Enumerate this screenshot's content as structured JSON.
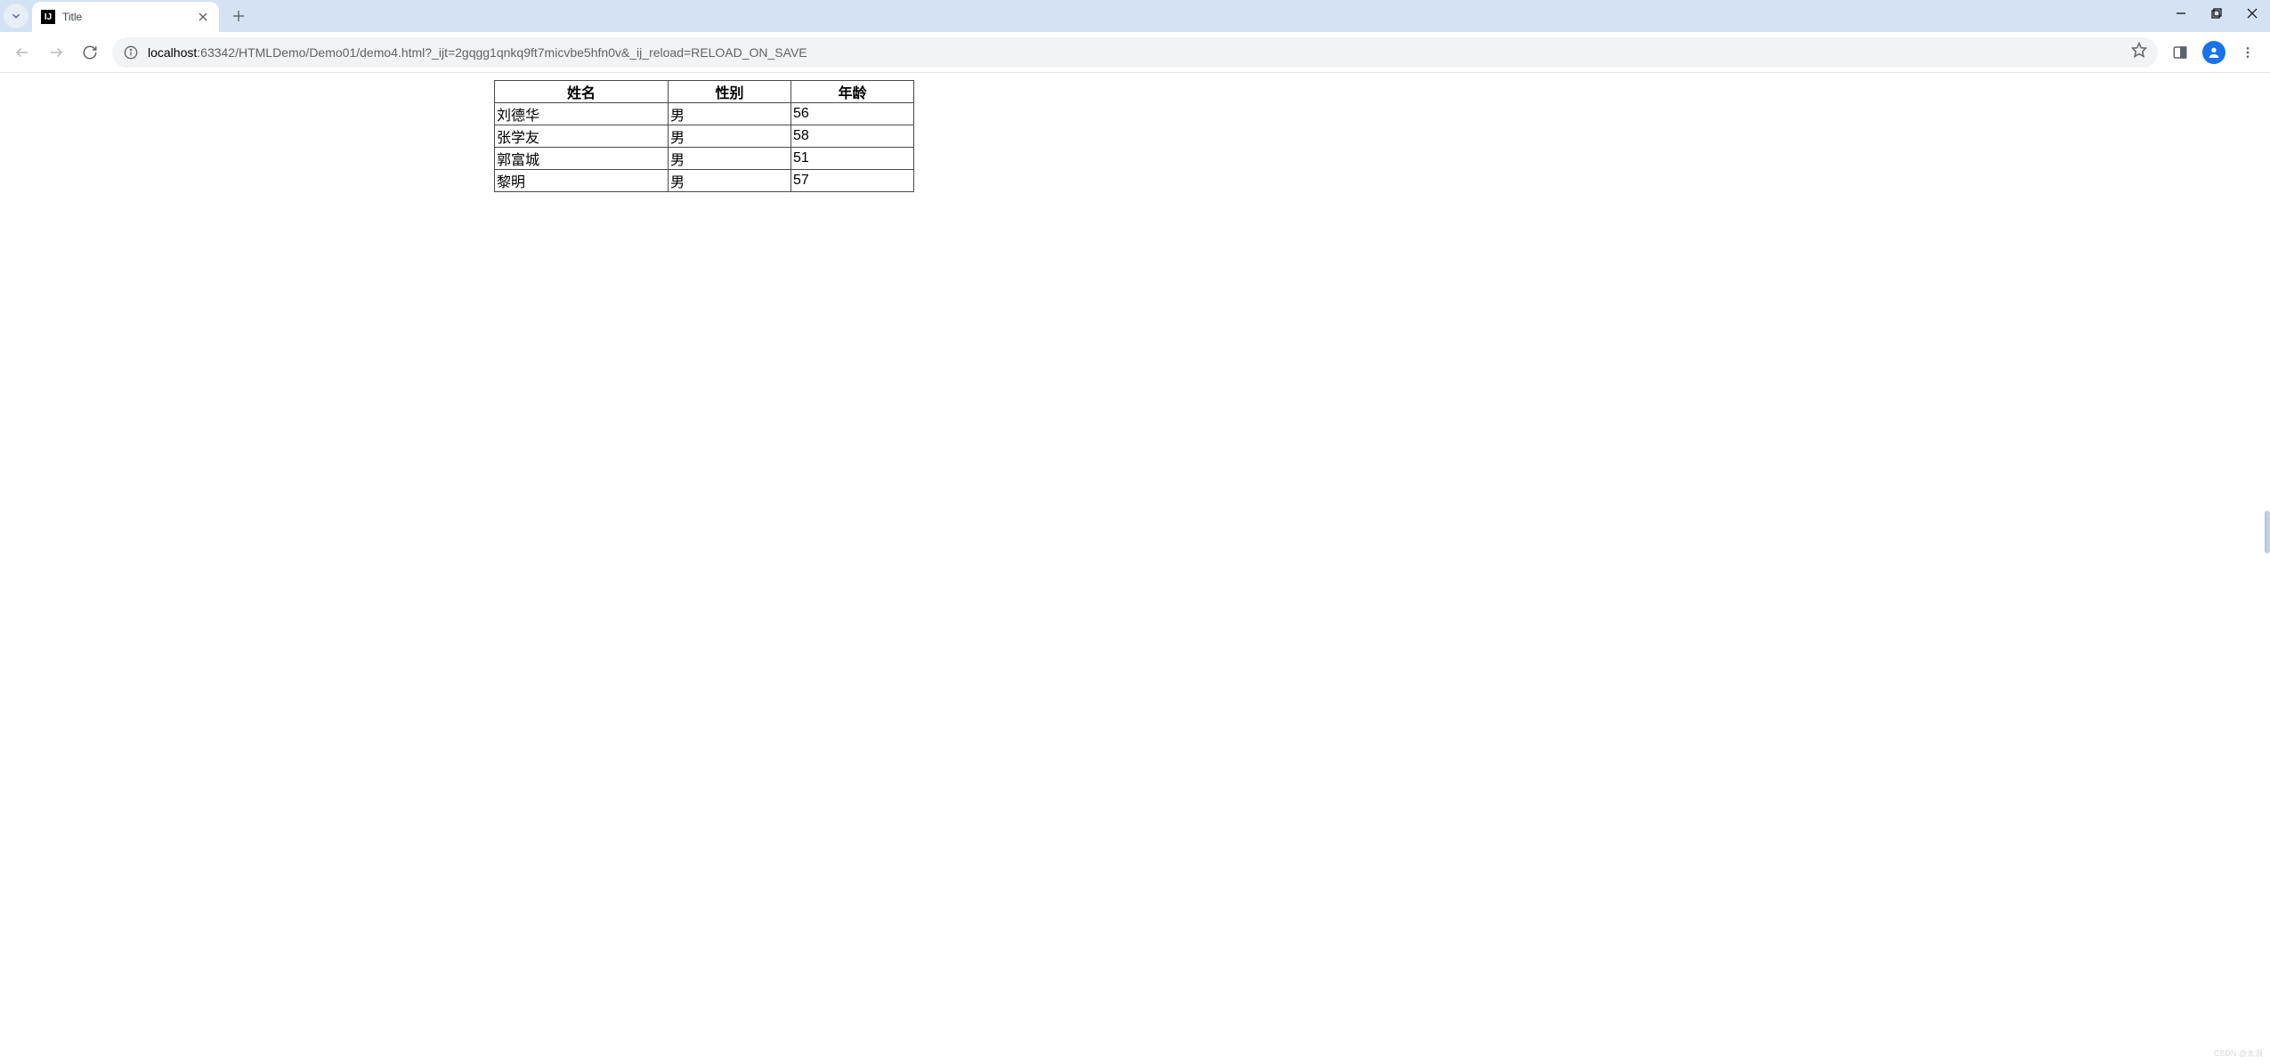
{
  "browser": {
    "tab_title": "Title",
    "url_host": "localhost",
    "url_port_path": ":63342/HTMLDemo/Demo01/demo4.html?_ijt=2gqgg1qnkq9ft7micvbe5hfn0v&_ij_reload=RELOAD_ON_SAVE"
  },
  "table": {
    "headers": [
      "姓名",
      "性别",
      "年龄"
    ],
    "rows": [
      {
        "name": "刘德华",
        "gender": "男",
        "age": "56"
      },
      {
        "name": "张学友",
        "gender": "男",
        "age": "58"
      },
      {
        "name": "郭富城",
        "gender": "男",
        "age": "51"
      },
      {
        "name": "黎明",
        "gender": "男",
        "age": "57"
      }
    ]
  },
  "watermark": "CSDN @太浪"
}
